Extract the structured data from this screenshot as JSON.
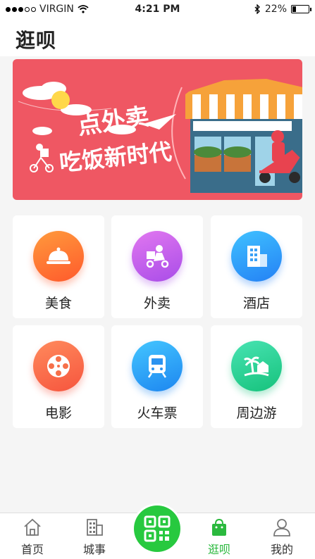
{
  "status_bar": {
    "carrier": "VIRGIN",
    "time": "4:21 PM",
    "battery_percent": "22%",
    "battery_level": 0.22,
    "icons": [
      "signal-dots-icon",
      "wifi-icon",
      "bluetooth-icon",
      "battery-icon"
    ]
  },
  "header": {
    "title": "逛呗"
  },
  "banner": {
    "icon_names": [
      "cloud-icon",
      "sun-icon",
      "paper-plane-icon",
      "delivery-scooter-icon",
      "storefront-icon"
    ],
    "colors": {
      "background": "#ef5763",
      "text": "#ffffff"
    }
  },
  "grid": {
    "items": [
      {
        "label": "美食",
        "icon": "food-cloche-icon",
        "color_from": "#ff9a3c",
        "color_to": "#ff5a2c"
      },
      {
        "label": "外卖",
        "icon": "delivery-icon",
        "color_from": "#e177f0",
        "color_to": "#a94de8"
      },
      {
        "label": "酒店",
        "icon": "hotel-building-icon",
        "color_from": "#3fc1ff",
        "color_to": "#2481f5"
      },
      {
        "label": "电影",
        "icon": "film-reel-icon",
        "color_from": "#ff8a5c",
        "color_to": "#f6553e"
      },
      {
        "label": "火车票",
        "icon": "train-icon",
        "color_from": "#44c6ff",
        "color_to": "#1d86f0"
      },
      {
        "label": "周边游",
        "icon": "island-palm-icon",
        "color_from": "#48e3b2",
        "color_to": "#16c27c"
      }
    ]
  },
  "tab_bar": {
    "tabs": [
      {
        "label": "首页",
        "icon": "home-icon"
      },
      {
        "label": "城事",
        "icon": "building-icon"
      },
      {
        "label": "逛呗",
        "icon": "shopping-bag-icon",
        "active": true
      },
      {
        "label": "我的",
        "icon": "user-icon"
      }
    ],
    "scan_icon": "qr-scan-icon",
    "accent_color": "#2bb93e"
  }
}
